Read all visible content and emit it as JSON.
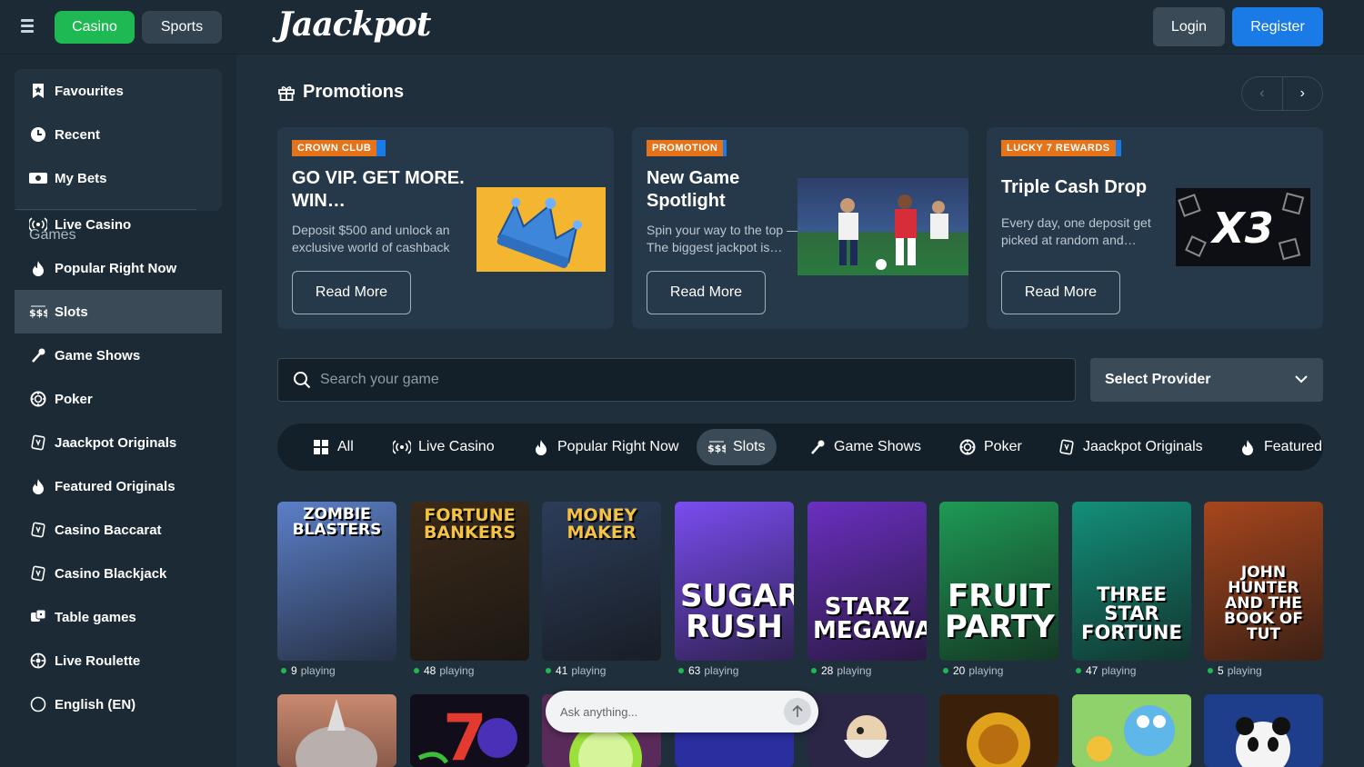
{
  "header": {
    "casino": "Casino",
    "sports": "Sports",
    "logo": "Jaackpot",
    "login": "Login",
    "register": "Register"
  },
  "sidebar": {
    "top": [
      {
        "label": "Favourites",
        "icon": "bookmark-icon"
      },
      {
        "label": "Recent",
        "icon": "clock-icon"
      },
      {
        "label": "My Bets",
        "icon": "ticket-icon"
      }
    ],
    "section": "Games",
    "items": [
      {
        "label": "Live Casino",
        "icon": "broadcast-icon"
      },
      {
        "label": "Popular Right Now",
        "icon": "flame-icon"
      },
      {
        "label": "Slots",
        "icon": "slots-icon",
        "active": true
      },
      {
        "label": "Game Shows",
        "icon": "microphone-icon"
      },
      {
        "label": "Poker",
        "icon": "poker-chip-icon"
      },
      {
        "label": "Jaackpot Originals",
        "icon": "cards-icon"
      },
      {
        "label": "Featured Originals",
        "icon": "flame-icon"
      },
      {
        "label": "Casino Baccarat",
        "icon": "cards-icon"
      },
      {
        "label": "Casino Blackjack",
        "icon": "cards-icon"
      },
      {
        "label": "Table games",
        "icon": "dice-icon"
      },
      {
        "label": "Live Roulette",
        "icon": "roulette-icon"
      },
      {
        "label": "English (EN)",
        "icon": "globe-icon"
      }
    ]
  },
  "promotions": {
    "title": "Promotions",
    "cards": [
      {
        "tag": "CROWN CLUB",
        "title": "GO VIP. GET MORE. WIN…",
        "desc": "Deposit $500 and unlock an exclusive world of cashback",
        "cta": "Read More"
      },
      {
        "tag": "PROMOTION",
        "title": "New Game Spotlight",
        "desc": "Spin your way to the top — The biggest jackpot is…",
        "cta": "Read More"
      },
      {
        "tag": "LUCKY 7 REWARDS",
        "title": "Triple Cash Drop",
        "desc": "Every day, one deposit get picked at random and…",
        "cta": "Read More",
        "badge": "X3"
      }
    ]
  },
  "search": {
    "placeholder": "Search your game"
  },
  "provider": {
    "label": "Select Provider"
  },
  "categories": [
    {
      "label": "All",
      "icon": "grid-icon"
    },
    {
      "label": "Live Casino",
      "icon": "broadcast-icon"
    },
    {
      "label": "Popular Right Now",
      "icon": "flame-icon"
    },
    {
      "label": "Slots",
      "icon": "slots-icon",
      "active": true
    },
    {
      "label": "Game Shows",
      "icon": "microphone-icon"
    },
    {
      "label": "Poker",
      "icon": "poker-chip-icon"
    },
    {
      "label": "Jaackpot Originals",
      "icon": "cards-icon"
    },
    {
      "label": "Featured Originals",
      "icon": "flame-icon"
    }
  ],
  "games": [
    {
      "title": "ZOMBIE BLASTERS",
      "playing": "9",
      "suffix": "playing",
      "bg": "#5b7fc7"
    },
    {
      "title": "FORTUNE BANKERS",
      "playing": "48",
      "suffix": "playing",
      "bg": "#3b2a1a"
    },
    {
      "title": "MONEY MAKER",
      "playing": "41",
      "suffix": "playing",
      "bg": "#2c3d5a"
    },
    {
      "title": "SUGAR RUSH",
      "playing": "63",
      "suffix": "playing",
      "bg": "#7a4cf0"
    },
    {
      "title": "STARZ MEGAWAYS",
      "playing": "28",
      "suffix": "playing",
      "bg": "#6a2fc0"
    },
    {
      "title": "FRUIT PARTY",
      "playing": "20",
      "suffix": "playing",
      "bg": "#1e9a55"
    },
    {
      "title": "THREE STAR FORTUNE",
      "playing": "47",
      "suffix": "playing",
      "bg": "#138f7a"
    },
    {
      "title": "JOHN HUNTER AND THE BOOK OF TUT",
      "playing": "5",
      "suffix": "playing",
      "bg": "#a7461d"
    }
  ],
  "ask": {
    "placeholder": "Ask anything..."
  }
}
